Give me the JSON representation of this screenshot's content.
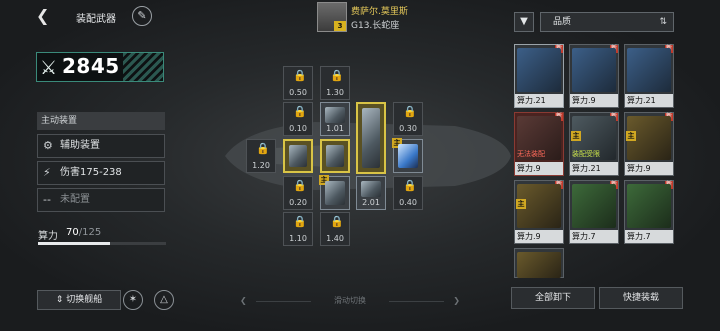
{
  "header": {
    "title": "装配武器",
    "back_icon": "back-arrow-icon",
    "edit_icon": "edit-icon"
  },
  "pilot": {
    "name": "费萨尔.莫里斯",
    "subtitle": "G13.长蛇座",
    "level": "3"
  },
  "power": {
    "value": "2845"
  },
  "active_section": {
    "header": "主动装置",
    "rows": [
      {
        "icon": "device-icon",
        "label": "辅助装置"
      },
      {
        "icon": "damage-icon",
        "label": "伤害175-238"
      },
      {
        "icon": "empty-icon",
        "label": "未配置"
      }
    ]
  },
  "calc": {
    "label": "算力",
    "used": "70",
    "total": "/125",
    "fraction": 0.56
  },
  "bottom": {
    "switch_label": "切换舰船",
    "slide_label": "滑动切换"
  },
  "slots": [
    {
      "id": "s1",
      "value": "0.50",
      "locked": true
    },
    {
      "id": "s2",
      "value": "1.30",
      "locked": true
    },
    {
      "id": "s3",
      "value": "0.10",
      "locked": true
    },
    {
      "id": "s4",
      "value": "1.01",
      "locked": false
    },
    {
      "id": "s5",
      "value": "0.30",
      "locked": true
    },
    {
      "id": "s6",
      "value": "1.20",
      "locked": true
    },
    {
      "id": "s7",
      "value": "0.20",
      "locked": true
    },
    {
      "id": "s8",
      "value": "2.01",
      "locked": false
    },
    {
      "id": "s9",
      "value": "0.40",
      "locked": true
    },
    {
      "id": "s10",
      "value": "1.10",
      "locked": true
    },
    {
      "id": "s11",
      "value": "1.40",
      "locked": true
    }
  ],
  "inventory": {
    "filter_icon": "filter-icon",
    "sort_label": "品质",
    "cards": [
      {
        "power": "算力.21",
        "new": true
      },
      {
        "power": "算力.9",
        "new": true
      },
      {
        "power": "算力.21",
        "new": true
      },
      {
        "power": "算力.9",
        "new": true,
        "warn": "无法装配",
        "red": true
      },
      {
        "power": "算力.21",
        "new": true,
        "warn": "装配受限",
        "tag": "主"
      },
      {
        "power": "算力.9",
        "new": true,
        "tag": "主"
      },
      {
        "power": "算力.9",
        "new": true,
        "tag": "主"
      },
      {
        "power": "算力.7",
        "new": true
      },
      {
        "power": "算力.7",
        "new": true
      }
    ]
  },
  "actions": {
    "unload_all": "全部卸下",
    "quick_equip": "快捷装载"
  },
  "colors": {
    "accent_gold": "#d9c446",
    "power_border": "#3a8a7a",
    "warn_red": "#ff6a5a"
  }
}
